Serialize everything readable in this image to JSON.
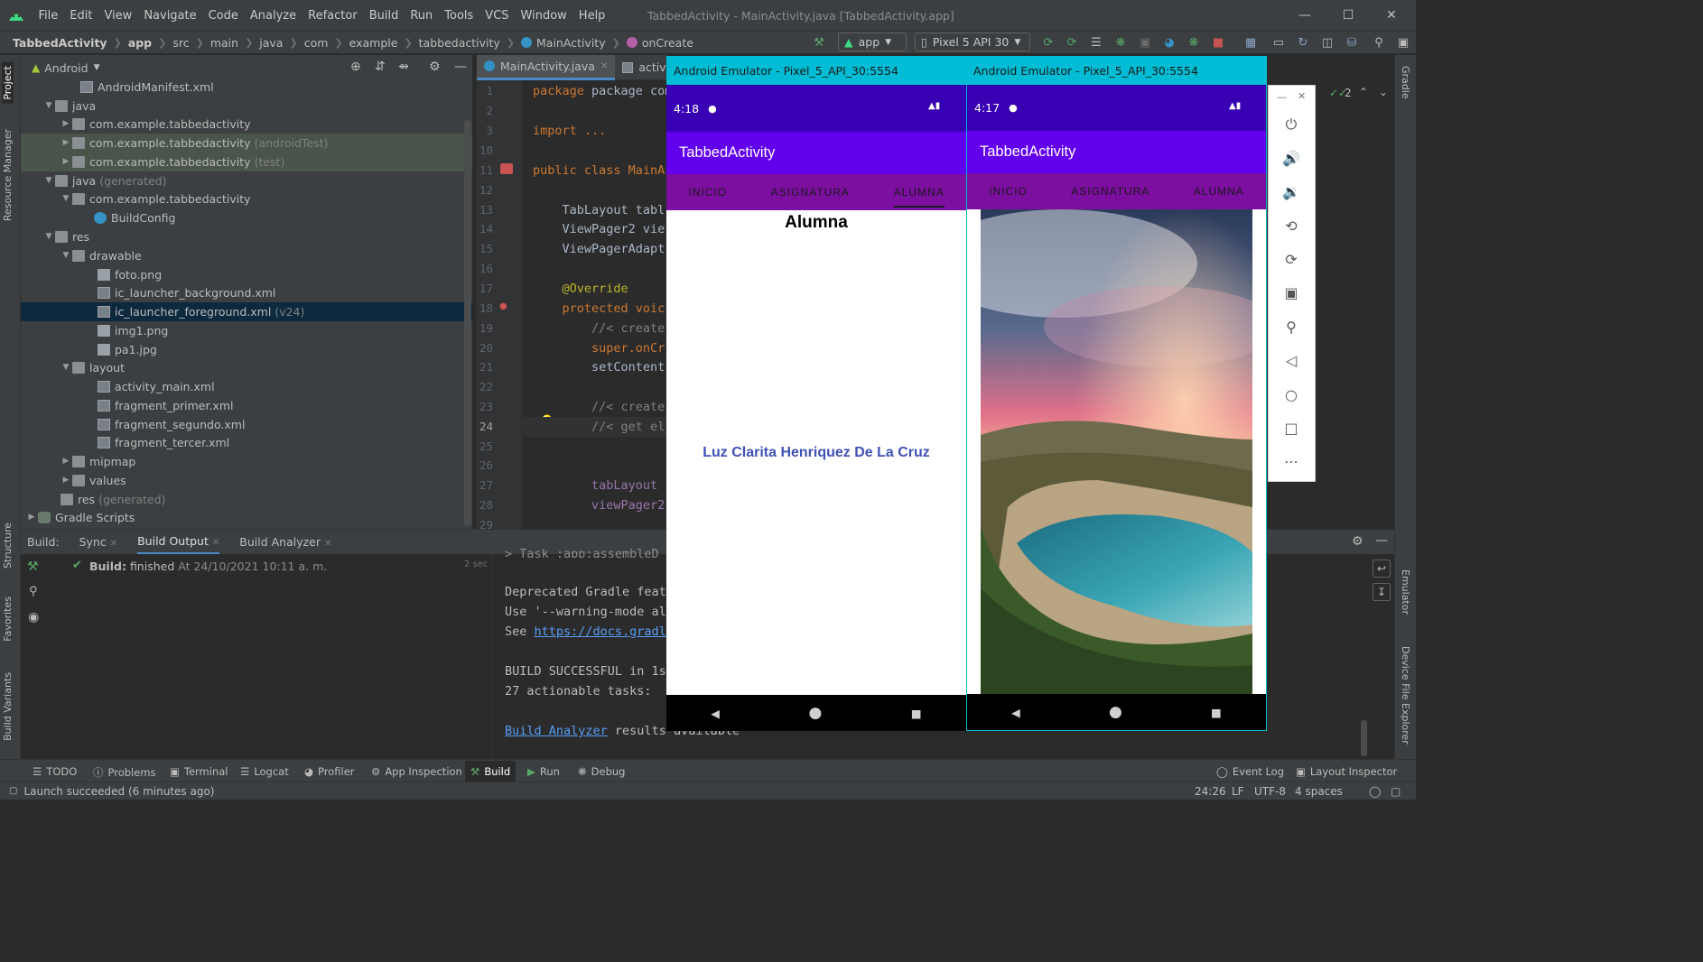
{
  "menubar": {
    "items": [
      "File",
      "Edit",
      "View",
      "Navigate",
      "Code",
      "Analyze",
      "Refactor",
      "Build",
      "Run",
      "Tools",
      "VCS",
      "Window",
      "Help"
    ],
    "window_title": "TabbedActivity - MainActivity.java [TabbedActivity.app]"
  },
  "navbar": {
    "breadcrumbs": [
      "TabbedActivity",
      "app",
      "src",
      "main",
      "java",
      "com",
      "example",
      "tabbedactivity",
      "MainActivity",
      "onCreate"
    ],
    "config": "app",
    "device": "Pixel 5 API 30"
  },
  "project": {
    "view_label": "Android",
    "rows": [
      {
        "label": "AndroidManifest.xml",
        "suffix": ""
      },
      {
        "label": "java",
        "suffix": ""
      },
      {
        "label": "com.example.tabbedactivity",
        "suffix": ""
      },
      {
        "label": "com.example.tabbedactivity",
        "suffix": "(androidTest)"
      },
      {
        "label": "com.example.tabbedactivity",
        "suffix": "(test)"
      },
      {
        "label": "java",
        "suffix": "(generated)"
      },
      {
        "label": "com.example.tabbedactivity",
        "suffix": ""
      },
      {
        "label": "BuildConfig",
        "suffix": ""
      },
      {
        "label": "res",
        "suffix": ""
      },
      {
        "label": "drawable",
        "suffix": ""
      },
      {
        "label": "foto.png",
        "suffix": ""
      },
      {
        "label": "ic_launcher_background.xml",
        "suffix": ""
      },
      {
        "label": "ic_launcher_foreground.xml",
        "suffix": "(v24)"
      },
      {
        "label": "img1.png",
        "suffix": ""
      },
      {
        "label": "pa1.jpg",
        "suffix": ""
      },
      {
        "label": "layout",
        "suffix": ""
      },
      {
        "label": "activity_main.xml",
        "suffix": ""
      },
      {
        "label": "fragment_primer.xml",
        "suffix": ""
      },
      {
        "label": "fragment_segundo.xml",
        "suffix": ""
      },
      {
        "label": "fragment_tercer.xml",
        "suffix": ""
      },
      {
        "label": "mipmap",
        "suffix": ""
      },
      {
        "label": "values",
        "suffix": ""
      },
      {
        "label": "res",
        "suffix": "(generated)"
      },
      {
        "label": "Gradle Scripts",
        "suffix": ""
      }
    ]
  },
  "editor": {
    "tabs": [
      "MainActivity.java",
      "activity"
    ],
    "line_numbers": [
      "1",
      "2",
      "3",
      "10",
      "11",
      "12",
      "13",
      "14",
      "15",
      "16",
      "17",
      "18",
      "19",
      "20",
      "21",
      "22",
      "23",
      "24",
      "25",
      "26",
      "27",
      "28",
      "29"
    ],
    "lines": {
      "l1": "package com.exampl",
      "l3": "import ...",
      "l11": "public class MainA",
      "l13": "    TabLayout tabl",
      "l14": "    ViewPager2 vie",
      "l15": "    ViewPagerAdapt",
      "l17": "    @Override",
      "l18": "    protected voic",
      "l19": "        //< create",
      "l20": "        super.onCr",
      "l21": "        setContent",
      "l23": "        //< create",
      "l24": "        //< get el",
      "l27": "        tabLayout",
      "l28": "        viewPager2"
    }
  },
  "build": {
    "label": "Build:",
    "tabs": [
      "Sync",
      "Build Output",
      "Build Analyzer"
    ],
    "status_bold": "Build:",
    "status_text": "finished",
    "status_time": "At 24/10/2021 10:11 a. m.",
    "duration": "2 sec",
    "output": {
      "task": "> Task :app:assembleD",
      "dep1": "Deprecated Gradle feat",
      "dep2": "Use '--warning-mode al",
      "see": "See ",
      "see_link": "https://docs.gradl",
      "success": "BUILD SUCCESSFUL in 1s",
      "tasks": "27 actionable tasks: ",
      "analyzer_link": "Build Analyzer",
      "analyzer_rest": " results available"
    }
  },
  "bottom_tools": [
    "TODO",
    "Problems",
    "Terminal",
    "Logcat",
    "Profiler",
    "App Inspection",
    "Build",
    "Run",
    "Debug"
  ],
  "bottom_right_tools": [
    "Event Log",
    "Layout Inspector"
  ],
  "status": {
    "message": "Launch succeeded (6 minutes ago)",
    "position": "24:26",
    "line_sep": "LF",
    "encoding": "UTF-8",
    "indent": "4 spaces"
  },
  "left_tabs": [
    "Project",
    "Resource Manager",
    "Structure",
    "Favorites",
    "Build Variants"
  ],
  "right_tabs": [
    "Gradle",
    "Emulator",
    "Device File Explorer"
  ],
  "editor_inspections": "2",
  "emulator1": {
    "title": "Android Emulator - Pixel_5_API_30:5554",
    "time": "4:18",
    "app_title": "TabbedActivity",
    "tabs": [
      "INICIO",
      "ASIGNATURA",
      "ALUMNA"
    ],
    "heading": "Alumna",
    "name": "Luz Clarita Henriquez De La Cruz"
  },
  "emulator2": {
    "title": "Android Emulator - Pixel_5_API_30:5554",
    "time": "4:17",
    "app_title": "TabbedActivity",
    "tabs": [
      "INICIO",
      "ASIGNATURA",
      "ALUMNA"
    ]
  },
  "colors": {
    "status_bar": "#3700b3",
    "app_bar": "#6200ee",
    "tab_bar": "#7c0fa0",
    "emulator_title": "#00bcd4",
    "name_text": "#3f51b5"
  }
}
